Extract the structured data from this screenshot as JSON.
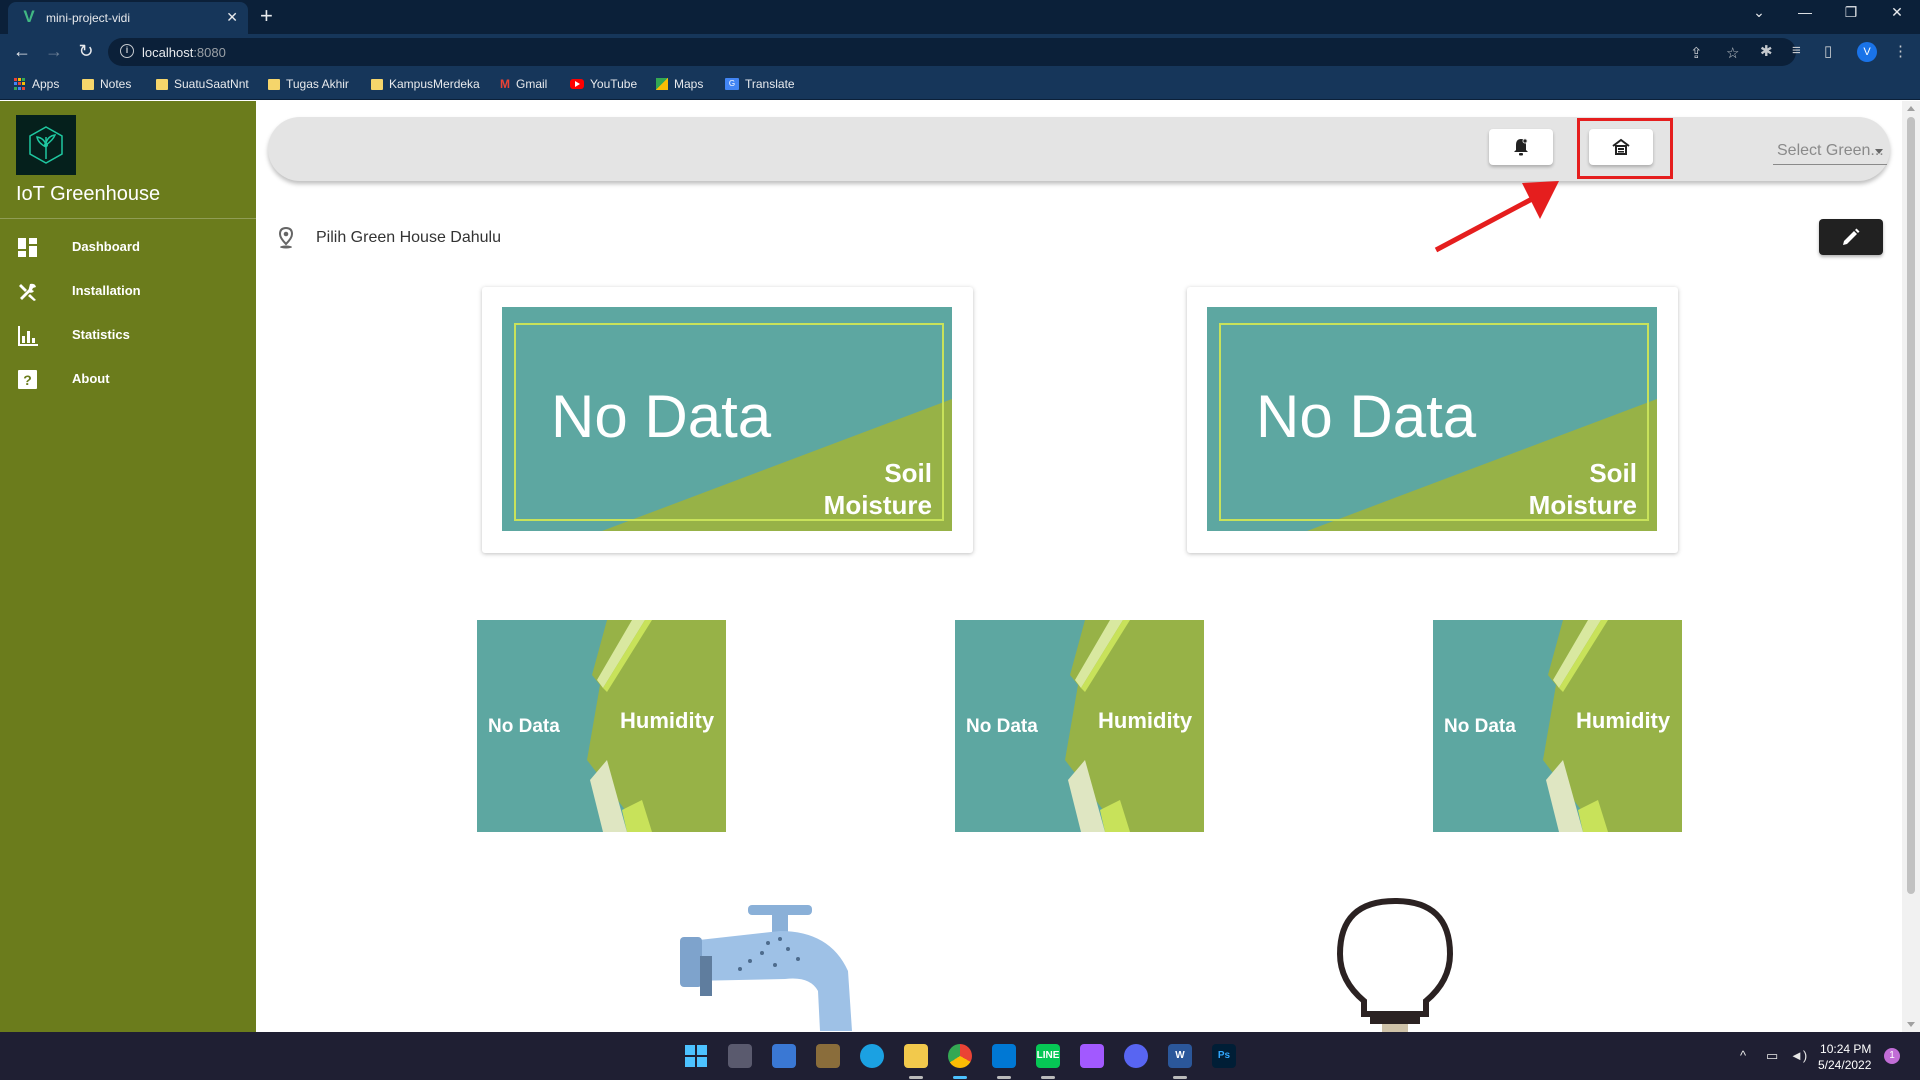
{
  "browser": {
    "tab_title": "mini-project-vidi",
    "url_host": "localhost",
    "url_port": ":8080",
    "profile_initial": "V",
    "bookmarks": [
      "Apps",
      "Notes",
      "SuatuSaatNnt",
      "Tugas Akhir",
      "KampusMerdeka",
      "Gmail",
      "YouTube",
      "Maps",
      "Translate"
    ]
  },
  "app": {
    "title": "IoT Greenhouse",
    "nav": [
      {
        "label": "Dashboard",
        "icon": "dashboard-icon"
      },
      {
        "label": "Installation",
        "icon": "tools-icon"
      },
      {
        "label": "Statistics",
        "icon": "bar-chart-icon"
      },
      {
        "label": "About",
        "icon": "help-icon"
      }
    ],
    "appbar": {
      "notification_icon": "bell-icon",
      "home_icon": "greenhouse-icon",
      "select_placeholder": "Select Green..."
    },
    "location_text": "Pilih Green House Dahulu",
    "soil_cards": [
      {
        "value": "No Data",
        "label_line1": "Soil",
        "label_line2": "Moisture"
      },
      {
        "value": "No Data",
        "label_line1": "Soil",
        "label_line2": "Moisture"
      }
    ],
    "humidity_tiles": [
      {
        "value": "No Data",
        "label": "Humidity"
      },
      {
        "value": "No Data",
        "label": "Humidity"
      },
      {
        "value": "No Data",
        "label": "Humidity"
      }
    ]
  },
  "taskbar": {
    "time": "10:24 PM",
    "date": "5/24/2022",
    "notification_count": "1"
  },
  "colors": {
    "sidebar": "#6b7c1c",
    "tile_teal": "#5da7a1",
    "tile_green": "#97b247",
    "highlight_red": "#e51e1e"
  }
}
